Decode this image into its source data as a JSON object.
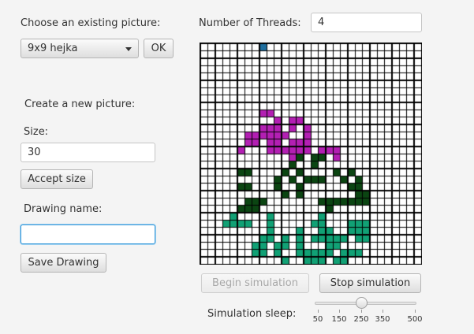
{
  "picture_chooser": {
    "label": "Choose an existing picture:",
    "selected": "9x9 hejka",
    "ok_label": "OK"
  },
  "threads": {
    "label": "Number of Threads:",
    "value": "4"
  },
  "new_picture": {
    "label": "Create a new picture:",
    "size_label": "Size:",
    "size_value": "30",
    "accept_label": "Accept size",
    "name_label": "Drawing name:",
    "name_value": "",
    "save_label": "Save Drawing"
  },
  "simulation": {
    "begin_label": "Begin simulation",
    "stop_label": "Stop simulation",
    "sleep_label": "Simulation sleep:",
    "sleep_value": 250,
    "sleep_min": 50,
    "sleep_max": 500,
    "tick_labels": [
      "50",
      "150",
      "250",
      "350",
      "500"
    ]
  },
  "canvas": {
    "size": 30,
    "colors": {
      "blue": "#1f6f9f",
      "purple": "#b31fb3",
      "dark_green": "#0b4512",
      "teal_green": "#11a175"
    },
    "cells": {
      "blue": [
        [
          0,
          8
        ]
      ],
      "purple": [
        [
          9,
          8
        ],
        [
          9,
          9
        ],
        [
          10,
          10
        ],
        [
          10,
          12
        ],
        [
          10,
          13
        ],
        [
          11,
          8
        ],
        [
          11,
          9
        ],
        [
          11,
          10
        ],
        [
          11,
          12
        ],
        [
          11,
          14
        ],
        [
          12,
          6
        ],
        [
          12,
          7
        ],
        [
          12,
          8
        ],
        [
          12,
          9
        ],
        [
          12,
          10
        ],
        [
          12,
          11
        ],
        [
          12,
          14
        ],
        [
          13,
          6
        ],
        [
          13,
          7
        ],
        [
          13,
          9
        ],
        [
          13,
          10
        ],
        [
          13,
          12
        ],
        [
          13,
          13
        ],
        [
          13,
          14
        ],
        [
          14,
          5
        ],
        [
          14,
          9
        ],
        [
          14,
          10
        ],
        [
          14,
          11
        ],
        [
          14,
          12
        ],
        [
          14,
          13
        ],
        [
          14,
          14
        ],
        [
          14,
          16
        ],
        [
          14,
          17
        ],
        [
          14,
          18
        ],
        [
          15,
          12
        ],
        [
          15,
          15
        ],
        [
          15,
          18
        ]
      ],
      "dark_green": [
        [
          15,
          13
        ],
        [
          15,
          15
        ],
        [
          15,
          16
        ],
        [
          16,
          12
        ],
        [
          16,
          15
        ],
        [
          17,
          5
        ],
        [
          17,
          6
        ],
        [
          17,
          11
        ],
        [
          17,
          13
        ],
        [
          17,
          18
        ],
        [
          17,
          20
        ],
        [
          18,
          10
        ],
        [
          18,
          12
        ],
        [
          18,
          14
        ],
        [
          18,
          15
        ],
        [
          18,
          16
        ],
        [
          18,
          19
        ],
        [
          18,
          21
        ],
        [
          19,
          5
        ],
        [
          19,
          6
        ],
        [
          19,
          10
        ],
        [
          19,
          13
        ],
        [
          19,
          20
        ],
        [
          19,
          21
        ],
        [
          20,
          11
        ],
        [
          20,
          13
        ],
        [
          20,
          21
        ],
        [
          20,
          22
        ],
        [
          21,
          6
        ],
        [
          21,
          7
        ],
        [
          21,
          8
        ],
        [
          21,
          16
        ],
        [
          21,
          17
        ],
        [
          21,
          18
        ],
        [
          21,
          19
        ],
        [
          21,
          20
        ],
        [
          21,
          21
        ],
        [
          21,
          22
        ],
        [
          22,
          5
        ],
        [
          22,
          6
        ],
        [
          22,
          7
        ],
        [
          22,
          17
        ]
      ],
      "teal_green": [
        [
          23,
          4
        ],
        [
          23,
          9
        ],
        [
          23,
          16
        ],
        [
          24,
          3
        ],
        [
          24,
          4
        ],
        [
          24,
          5
        ],
        [
          24,
          6
        ],
        [
          24,
          9
        ],
        [
          24,
          15
        ],
        [
          24,
          16
        ],
        [
          24,
          20
        ],
        [
          24,
          21
        ],
        [
          24,
          22
        ],
        [
          25,
          9
        ],
        [
          25,
          13
        ],
        [
          25,
          16
        ],
        [
          25,
          17
        ],
        [
          25,
          20
        ],
        [
          25,
          21
        ],
        [
          25,
          22
        ],
        [
          26,
          8
        ],
        [
          26,
          9
        ],
        [
          26,
          11
        ],
        [
          26,
          13
        ],
        [
          26,
          15
        ],
        [
          26,
          16
        ],
        [
          26,
          17
        ],
        [
          26,
          18
        ],
        [
          26,
          19
        ],
        [
          26,
          21
        ],
        [
          26,
          22
        ],
        [
          27,
          7
        ],
        [
          27,
          8
        ],
        [
          27,
          10
        ],
        [
          27,
          11
        ],
        [
          27,
          13
        ],
        [
          27,
          17
        ],
        [
          27,
          18
        ],
        [
          28,
          7
        ],
        [
          28,
          8
        ],
        [
          28,
          10
        ],
        [
          28,
          13
        ],
        [
          28,
          14
        ],
        [
          28,
          15
        ],
        [
          28,
          16
        ],
        [
          28,
          17
        ],
        [
          28,
          19
        ],
        [
          28,
          20
        ],
        [
          28,
          21
        ],
        [
          29,
          11
        ],
        [
          29,
          14
        ],
        [
          29,
          15
        ],
        [
          29,
          16
        ],
        [
          29,
          18
        ],
        [
          29,
          19
        ]
      ]
    }
  }
}
